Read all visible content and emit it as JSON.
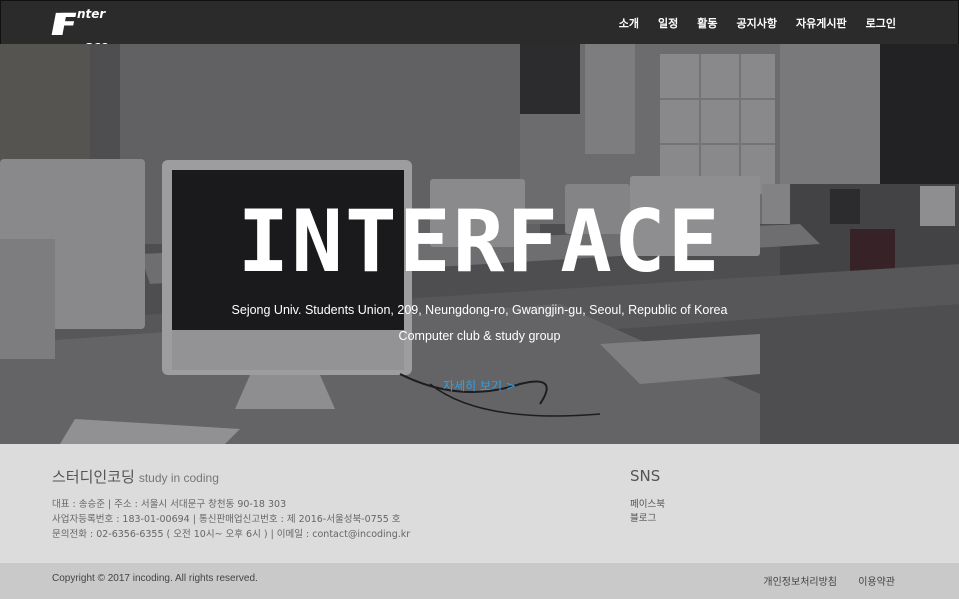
{
  "logo": {
    "mark": "IF",
    "top": "nter",
    "bottom": "ace"
  },
  "nav": {
    "items": [
      "소개",
      "일정",
      "활동",
      "공지사항",
      "자유게시판",
      "로그인"
    ]
  },
  "hero": {
    "title": "INTERFACE",
    "address": "Sejong Univ. Students Union, 209, Neungdong-ro, Gwangjin-gu, Seoul, Republic of Korea",
    "subtitle": "Computer club  &  study group",
    "link": "자세히 보기 >"
  },
  "footer": {
    "brand": "스터디인코딩",
    "brand_sub": "study in coding",
    "info": [
      "대표 : 송승준     |     주소 : 서울시 서대문구 창천동 90-18 303",
      "사업자등록번호 : 183-01-00694     |     통신판매업신고번호 : 제 2016-서울성북-0755 호",
      "문의전화 : 02-6356-6355 ( 오전 10시~ 오후 6시 )     |     이메일 : contact@incoding.kr"
    ],
    "sns_title": "SNS",
    "sns_links": [
      "페이스북",
      "블로그"
    ],
    "copyright": "Copyright © 2017 incoding. All rights reserved.",
    "bottom_links": [
      "개인정보처리방침",
      "이용약관"
    ]
  },
  "colors": {
    "nav_bg": "#2b2b2b",
    "link": "#2ea0ea",
    "footer_bg": "#dcdcdc",
    "bottom_bg": "#c9c9c9"
  }
}
